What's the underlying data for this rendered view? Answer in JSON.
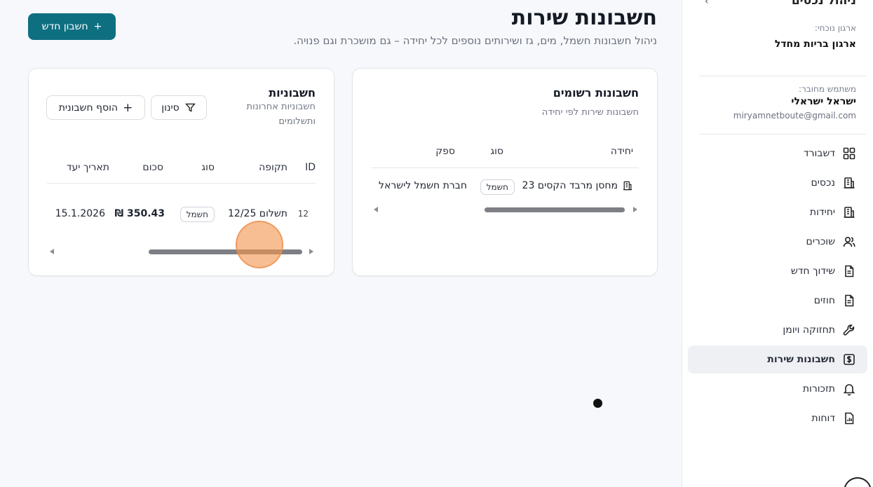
{
  "sidebar": {
    "header": "ניהול נכסים",
    "collapse_glyph": "‹",
    "org_label": "ארגון נוכחי:",
    "org_name": "ארגון בריות מחדל",
    "user_label": "משתמש מחובר:",
    "user_name": "ישראל ישראלי",
    "user_email": "miryamnetboute@gmail.com",
    "items": [
      {
        "label": "דשבורד",
        "icon": "dashboard-icon"
      },
      {
        "label": "נכסים",
        "icon": "building-icon"
      },
      {
        "label": "יחידות",
        "icon": "building-icon"
      },
      {
        "label": "שוכרים",
        "icon": "users-icon"
      },
      {
        "label": "שידוך חדש",
        "icon": "document-icon"
      },
      {
        "label": "חוזים",
        "icon": "document-icon"
      },
      {
        "label": "תחזוקה ויומן",
        "icon": "wrench-icon"
      },
      {
        "label": "חשבונות שירות",
        "icon": "dollar-icon",
        "active": true
      },
      {
        "label": "תזכורות",
        "icon": "bell-icon"
      },
      {
        "label": "דוחות",
        "icon": "report-icon"
      }
    ]
  },
  "header": {
    "title": "חשבונות שירות",
    "subtitle": "ניהול חשבונות חשמל, מים, גז ושירותים נוספים לכל יחידה – גם מושכרת וגם פנויה.",
    "new_button": "חשבון חדש",
    "new_button_icon": "+"
  },
  "accounts_card": {
    "title": "חשבונות רשומים",
    "subtitle": "חשבונות שירות לפי יחידה",
    "columns": [
      "יחידה",
      "סוג",
      "ספק"
    ],
    "rows": [
      {
        "unit": "מחסן מרבד הקסים 23",
        "type": "חשמל",
        "provider": "חברת חשמל לישראל"
      }
    ],
    "scroll_position": 0.85
  },
  "bills_card": {
    "title": "חשבוניות",
    "subtitle": "חשבוניות אחרונות ותשלומים",
    "filter_button": "סינון",
    "add_button": "הוסף חשבונית",
    "add_icon": "+",
    "columns": [
      "ID",
      "תקופה",
      "סוג",
      "סכום",
      "תאריך יעד"
    ],
    "rows": [
      {
        "id": "12",
        "period": "תשלום 12/25",
        "type": "חשמל",
        "amount": "₪ 350.43",
        "due": "15.1.2026"
      }
    ],
    "scroll_position": 0.9
  }
}
